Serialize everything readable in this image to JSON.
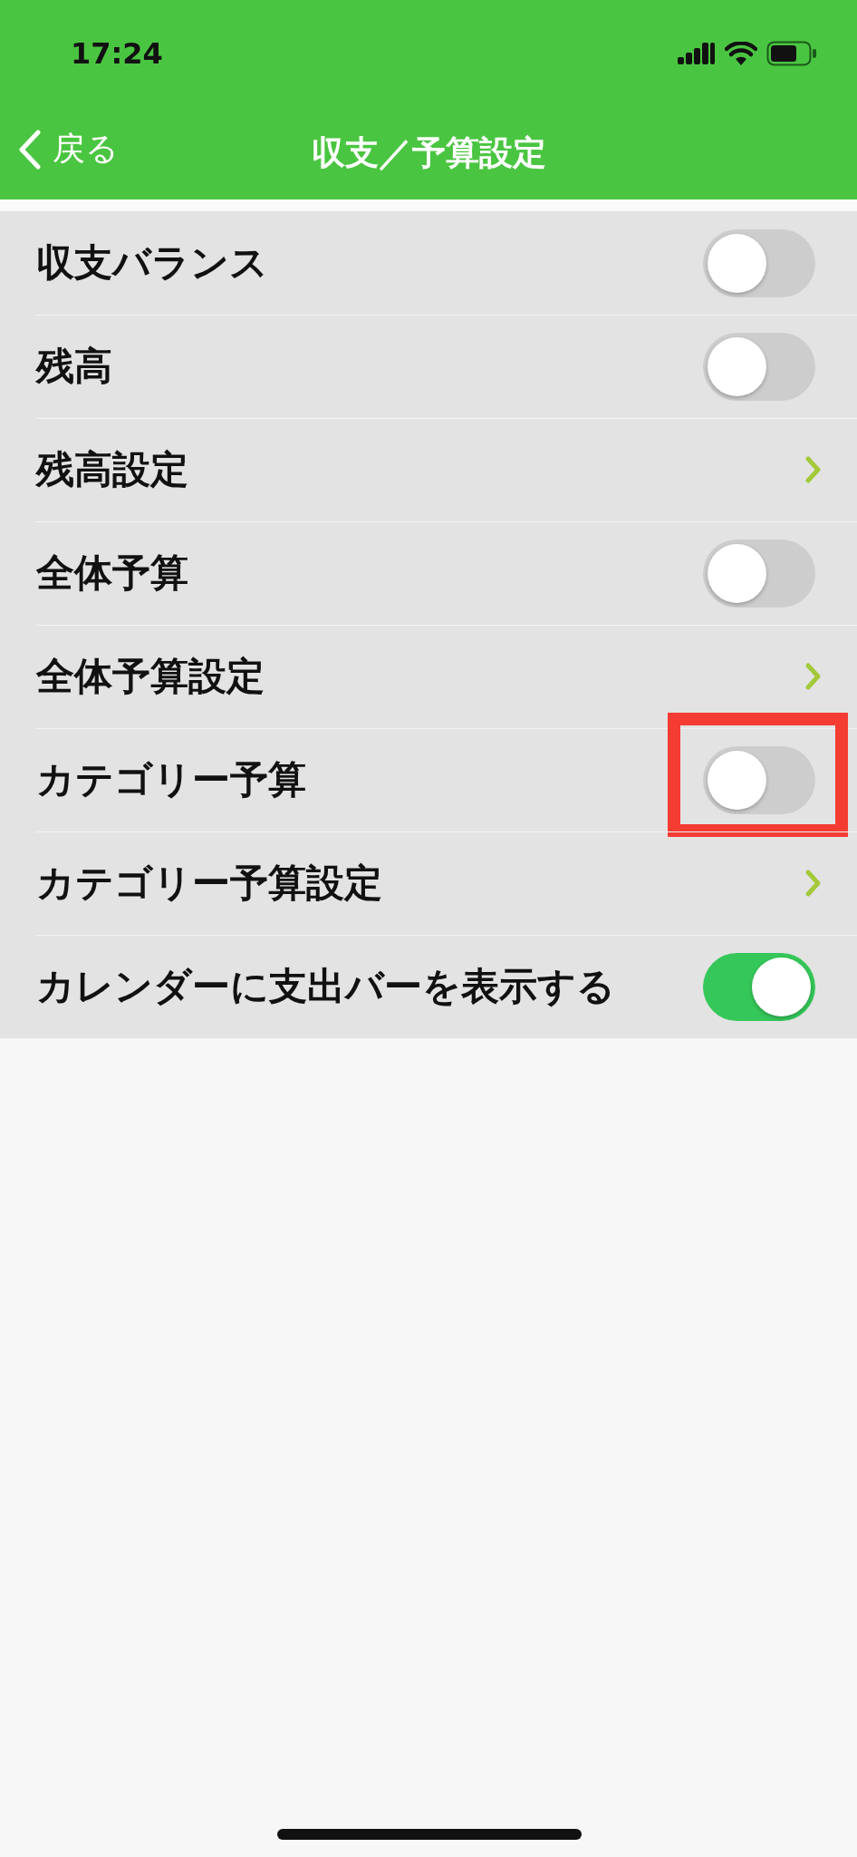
{
  "status_bar": {
    "time": "17:24"
  },
  "nav": {
    "back": "戻る",
    "title": "収支／予算設定"
  },
  "rows": [
    {
      "kind": "toggle",
      "label": "収支バランス",
      "on": false,
      "highlighted": false
    },
    {
      "kind": "toggle",
      "label": "残高",
      "on": false,
      "highlighted": false
    },
    {
      "kind": "link",
      "label": "残高設定",
      "highlighted": false
    },
    {
      "kind": "toggle",
      "label": "全体予算",
      "on": false,
      "highlighted": false
    },
    {
      "kind": "link",
      "label": "全体予算設定",
      "highlighted": false
    },
    {
      "kind": "toggle",
      "label": "カテゴリー予算",
      "on": false,
      "highlighted": true
    },
    {
      "kind": "link",
      "label": "カテゴリー予算設定",
      "highlighted": false
    },
    {
      "kind": "toggle",
      "label": "カレンダーに支出バーを表示する",
      "on": true,
      "highlighted": false
    }
  ]
}
